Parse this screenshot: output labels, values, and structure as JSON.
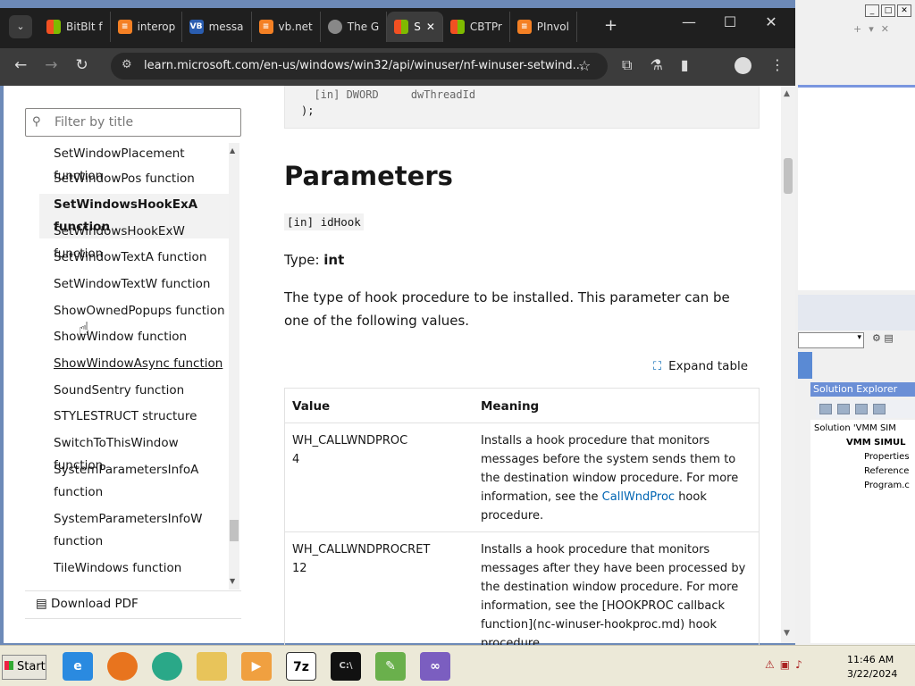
{
  "browser": {
    "tabs": [
      {
        "label": "BitBlt f",
        "favicon": "ms-icon"
      },
      {
        "label": "interop",
        "favicon": "so-icon"
      },
      {
        "label": "messa",
        "favicon": "vb-icon"
      },
      {
        "label": "vb.net",
        "favicon": "so-icon"
      },
      {
        "label": "The G",
        "favicon": "globe-icon"
      },
      {
        "label": "S",
        "favicon": "ms-icon",
        "active": true
      },
      {
        "label": "CBTPr",
        "favicon": "ms-icon"
      },
      {
        "label": "PInvol",
        "favicon": "so-icon"
      }
    ],
    "url": "learn.microsoft.com/en-us/windows/win32/api/winuser/nf-winuser-setwind..."
  },
  "toc": {
    "filter_placeholder": "Filter by title",
    "items": [
      {
        "label": "SetWindowPlacement function"
      },
      {
        "label": "SetWindowPos function"
      },
      {
        "label": "SetWindowsHookExA function",
        "selected": true
      },
      {
        "label": "SetWindowsHookExW function"
      },
      {
        "label": "SetWindowTextA function"
      },
      {
        "label": "SetWindowTextW function"
      },
      {
        "label": "ShowOwnedPopups function"
      },
      {
        "label": "ShowWindow function"
      },
      {
        "label": "ShowWindowAsync function",
        "hover": true
      },
      {
        "label": "SoundSentry function"
      },
      {
        "label": "STYLESTRUCT structure"
      },
      {
        "label": "SwitchToThisWindow function"
      },
      {
        "label": "SystemParametersInfoA",
        "label2": "function"
      },
      {
        "label": "SystemParametersInfoW",
        "label2": "function"
      },
      {
        "label": "TileWindows function"
      }
    ],
    "download": "Download PDF"
  },
  "content": {
    "code_line1": "  [in] DWORD     dwThreadId",
    "code_line2": ");",
    "heading": "Parameters",
    "param": "[in] idHook",
    "type_prefix": "Type: ",
    "type_value": "int",
    "desc": "The type of hook procedure to be installed. This parameter can be one of the following values.",
    "expand": "Expand table",
    "table": {
      "headers": [
        "Value",
        "Meaning"
      ],
      "rows": [
        {
          "value": "WH_CALLWNDPROC",
          "num": "4",
          "meaning_pre": "Installs a hook procedure that monitors messages before the system sends them to the destination window procedure. For more information, see the ",
          "meaning_link": "CallWndProc",
          "meaning_post": " hook procedure."
        },
        {
          "value": "WH_CALLWNDPROCRET",
          "num": "12",
          "meaning_pre": "Installs a hook procedure that monitors messages after they have been processed by the destination window procedure. For more information, see the [HOOKPROC callback function](nc-winuser-hookproc.md) hook procedure.",
          "meaning_link": "",
          "meaning_post": ""
        }
      ]
    }
  },
  "vs": {
    "solution_explorer": "Solution Explorer",
    "tree": [
      "Solution 'VMM SIM",
      "VMM SIMUL",
      "Properties",
      "Reference",
      "Program.c"
    ]
  },
  "taskbar": {
    "start": "Start",
    "time": "11:46 AM",
    "date": "3/22/2024",
    "apps": [
      "ie-icon",
      "firefox-icon",
      "chat-icon",
      "folder-icon",
      "media-icon",
      "7z-icon",
      "cmd-icon",
      "notepad-icon",
      "vs-icon"
    ]
  }
}
